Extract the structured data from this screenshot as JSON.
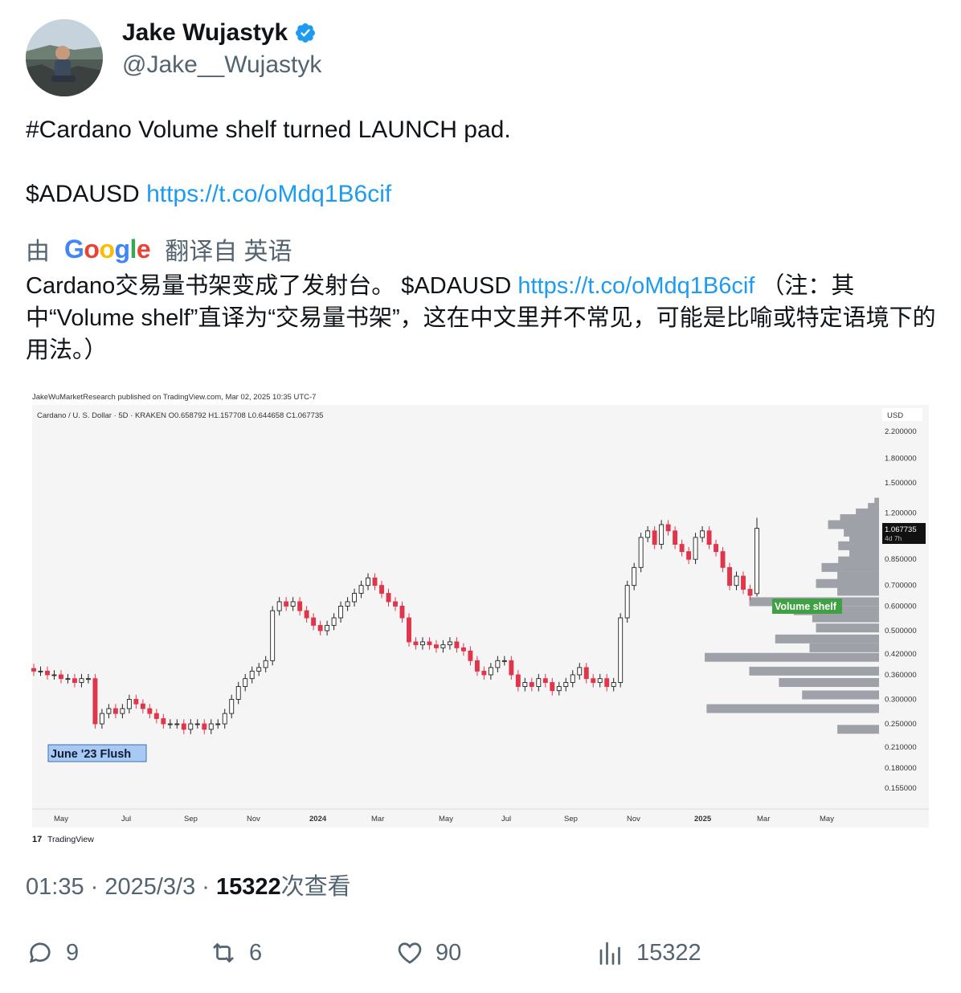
{
  "author": {
    "name": "Jake Wujastyk",
    "handle": "@Jake__Wujastyk"
  },
  "tweet": {
    "line1": "#Cardano Volume shelf turned LAUNCH pad.",
    "ticker": "$ADAUSD",
    "link": "https://t.co/oMdq1B6cif"
  },
  "translation": {
    "by": "由",
    "google": "Google",
    "from": "翻译自 英语",
    "part1": "Cardano交易量书架变成了发射台。 $ADAUSD ",
    "link": "https://t.co/oMdq1B6cif",
    "part2": " （注：其中“Volume shelf”直译为“交易量书架”，这在中文里并不常见，可能是比喻或特定语境下的用法。）"
  },
  "chart": {
    "published": "JakeWuMarketResearch published on TradingView.com, Mar 02, 2025 10:35 UTC-7",
    "symbol": "Cardano / U. S. Dollar · 5D · KRAKEN  O0.658792  H1.157708  L0.644658  C1.067735",
    "currency": "USD",
    "price_badge": "1.067735",
    "price_badge_sub": "4d 7h",
    "annotation_shelf": "Volume shelf",
    "annotation_flush": "June '23 Flush",
    "brand": "TradingView"
  },
  "chart_data": {
    "type": "candlestick",
    "title": "Cardano / U. S. Dollar · 5D · KRAKEN",
    "ohlc_last": {
      "open": 0.658792,
      "high": 1.157708,
      "low": 0.644658,
      "close": 1.067735
    },
    "y_scale": "log",
    "y_ticks": [
      2.2,
      1.8,
      1.5,
      1.2,
      0.85,
      0.7,
      0.6,
      0.5,
      0.42,
      0.36,
      0.3,
      0.25,
      0.21,
      0.18,
      0.155
    ],
    "y_tick_labels": [
      "2.200000",
      "1.800000",
      "1.500000",
      "1.200000",
      "0.850000",
      "0.700000",
      "0.600000",
      "0.500000",
      "0.420000",
      "0.360000",
      "0.300000",
      "0.250000",
      "0.210000",
      "0.180000",
      "0.155000"
    ],
    "x_tick_labels": [
      "May",
      "Jul",
      "Sep",
      "Nov",
      "2024",
      "Mar",
      "May",
      "Jul",
      "Sep",
      "Nov",
      "2025",
      "Mar",
      "May"
    ],
    "close_series": [
      0.37,
      0.37,
      0.36,
      0.36,
      0.35,
      0.35,
      0.34,
      0.35,
      0.35,
      0.25,
      0.27,
      0.28,
      0.27,
      0.28,
      0.3,
      0.29,
      0.28,
      0.27,
      0.26,
      0.25,
      0.25,
      0.25,
      0.24,
      0.25,
      0.25,
      0.24,
      0.25,
      0.25,
      0.27,
      0.3,
      0.33,
      0.35,
      0.37,
      0.38,
      0.4,
      0.58,
      0.62,
      0.6,
      0.62,
      0.58,
      0.55,
      0.52,
      0.5,
      0.52,
      0.55,
      0.6,
      0.62,
      0.66,
      0.7,
      0.74,
      0.7,
      0.66,
      0.62,
      0.6,
      0.55,
      0.46,
      0.45,
      0.46,
      0.45,
      0.44,
      0.45,
      0.46,
      0.44,
      0.43,
      0.4,
      0.37,
      0.36,
      0.38,
      0.4,
      0.4,
      0.36,
      0.33,
      0.34,
      0.33,
      0.35,
      0.34,
      0.32,
      0.33,
      0.34,
      0.36,
      0.38,
      0.35,
      0.34,
      0.35,
      0.33,
      0.34,
      0.55,
      0.7,
      0.8,
      1.0,
      1.05,
      0.95,
      1.1,
      1.05,
      0.95,
      0.9,
      0.85,
      1.0,
      1.05,
      0.95,
      0.9,
      0.8,
      0.7,
      0.75,
      0.68,
      0.65,
      1.07
    ],
    "volume_profile": [
      {
        "price": 1.3,
        "volume": 5
      },
      {
        "price": 1.25,
        "volume": 12
      },
      {
        "price": 1.2,
        "volume": 25
      },
      {
        "price": 1.15,
        "volume": 42
      },
      {
        "price": 1.1,
        "volume": 55
      },
      {
        "price": 1.04,
        "volume": 38
      },
      {
        "price": 0.99,
        "volume": 32
      },
      {
        "price": 0.94,
        "volume": 44
      },
      {
        "price": 0.89,
        "volume": 32
      },
      {
        "price": 0.84,
        "volume": 44
      },
      {
        "price": 0.8,
        "volume": 62
      },
      {
        "price": 0.75,
        "volume": 45
      },
      {
        "price": 0.71,
        "volume": 68
      },
      {
        "price": 0.67,
        "volume": 45
      },
      {
        "price": 0.62,
        "volume": 140
      },
      {
        "price": 0.58,
        "volume": 92
      },
      {
        "price": 0.55,
        "volume": 72
      },
      {
        "price": 0.51,
        "volume": 68
      },
      {
        "price": 0.47,
        "volume": 112
      },
      {
        "price": 0.44,
        "volume": 75
      },
      {
        "price": 0.41,
        "volume": 188
      },
      {
        "price": 0.37,
        "volume": 140
      },
      {
        "price": 0.34,
        "volume": 108
      },
      {
        "price": 0.31,
        "volume": 83
      },
      {
        "price": 0.28,
        "volume": 186
      },
      {
        "price": 0.24,
        "volume": 45
      }
    ]
  },
  "meta": {
    "time": "01:35 · 2025/3/3 · ",
    "views": "15322",
    "views_label": "次查看"
  },
  "actions": {
    "replies": "9",
    "retweets": "6",
    "likes": "90",
    "views": "15322"
  },
  "colors": {
    "link": "#1d9bf0",
    "verified": "#1d9bf0",
    "candle_up": "#ffffff",
    "candle_down": "#e0354a",
    "volume": "#9ea1a8",
    "shelf_label": "#3fa143",
    "flush_label": "#a9c9f5"
  }
}
